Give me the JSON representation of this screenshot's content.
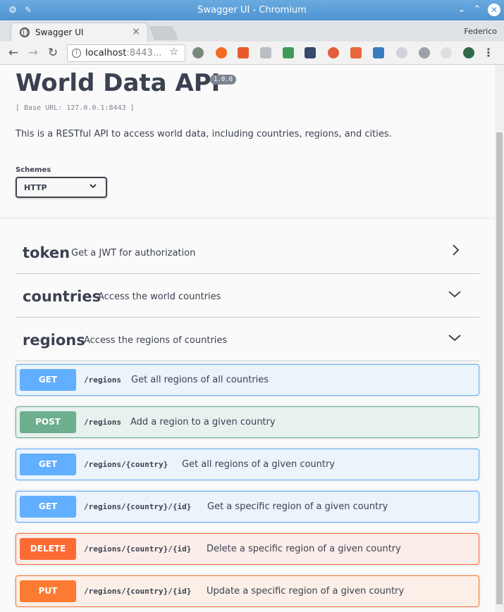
{
  "window": {
    "title": "Swagger UI - Chromium"
  },
  "tab": {
    "label": "Swagger UI",
    "close": "×"
  },
  "profile": {
    "user": "Federico"
  },
  "toolbar": {
    "url_host": "localhost",
    "url_rest": ":8443...",
    "back": "←",
    "forward": "→",
    "reload": "↻",
    "star": "☆",
    "menu": "⋮"
  },
  "api": {
    "title": "World Data API",
    "version": "1.0.0",
    "base_url": "[ Base URL: 127.0.0.1:8443 ]",
    "description": "This is a RESTful API to access world data, including countries, regions, and cities."
  },
  "schemes": {
    "label": "Schemes",
    "selected": "HTTP"
  },
  "tags": [
    {
      "name": "token",
      "description": "Get a JWT for authorization",
      "state": "collapsed"
    },
    {
      "name": "countries",
      "description": "Access the world countries",
      "state": "expandable"
    },
    {
      "name": "regions",
      "description": "Access the regions of countries",
      "state": "expanded"
    }
  ],
  "operations": [
    {
      "method": "GET",
      "path": "/regions",
      "summary": "Get all regions of all countries"
    },
    {
      "method": "POST",
      "path": "/regions",
      "summary": "Add a region to a given country"
    },
    {
      "method": "GET",
      "path": "/regions/{country}",
      "summary": "Get all regions of a given country"
    },
    {
      "method": "GET",
      "path": "/regions/{country}/{id}",
      "summary": "Get a specific region of a given country"
    },
    {
      "method": "DELETE",
      "path": "/regions/{country}/{id}",
      "summary": "Delete a specific region of a given country"
    },
    {
      "method": "PUT",
      "path": "/regions/{country}/{id}",
      "summary": "Update a specific region of a given country"
    }
  ]
}
